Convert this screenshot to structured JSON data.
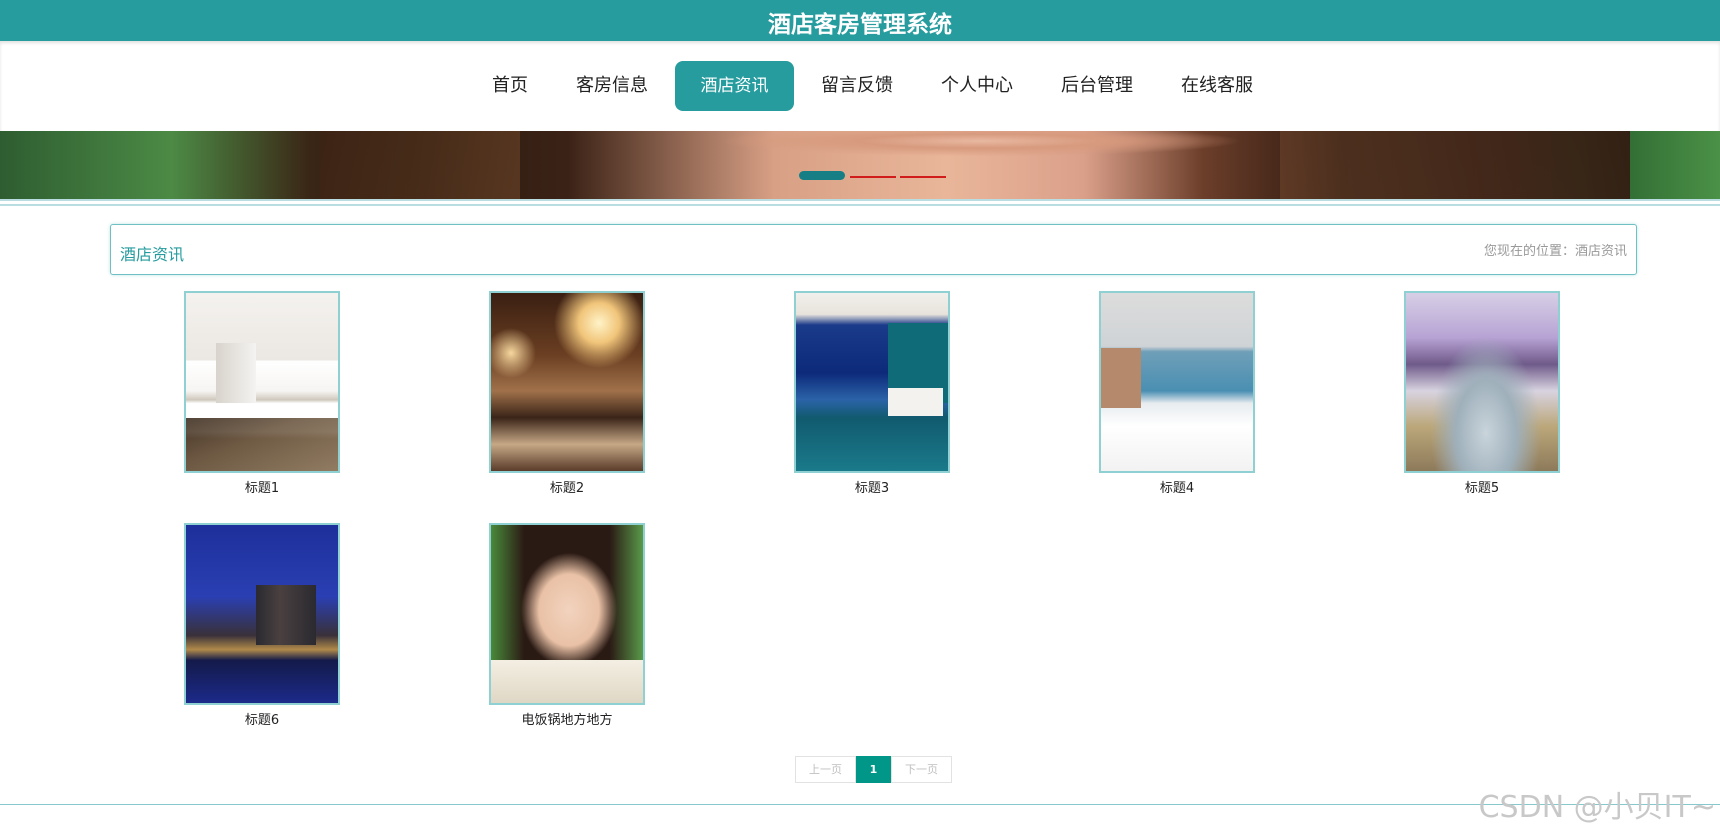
{
  "header": {
    "title": "酒店客房管理系统"
  },
  "nav": {
    "items": [
      {
        "label": "首页",
        "active": false
      },
      {
        "label": "客房信息",
        "active": false
      },
      {
        "label": "酒店资讯",
        "active": true
      },
      {
        "label": "留言反馈",
        "active": false
      },
      {
        "label": "个人中心",
        "active": false
      },
      {
        "label": "后台管理",
        "active": false
      },
      {
        "label": "在线客服",
        "active": false
      }
    ],
    "accent_color": "#279c9f"
  },
  "banner": {
    "slides": 3,
    "active_slide": 1
  },
  "breadcrumb": {
    "title": "酒店资讯",
    "position_text": "您现在的位置：酒店资讯"
  },
  "news": {
    "items": [
      {
        "label": "标题1",
        "image": "hotel-bedroom-image"
      },
      {
        "label": "标题2",
        "image": "banquet-hall-image"
      },
      {
        "label": "标题3",
        "image": "city-view-room-image"
      },
      {
        "label": "标题4",
        "image": "sea-view-room-image"
      },
      {
        "label": "标题5",
        "image": "suite-bathtub-image"
      },
      {
        "label": "标题6",
        "image": "night-cityscape-image"
      },
      {
        "label": "电饭锅地方地方",
        "image": "portrait-image"
      }
    ]
  },
  "pagination": {
    "prev_label": "上一页",
    "current": "1",
    "next_label": "下一页"
  },
  "watermark": "CSDN @小贝IT~"
}
